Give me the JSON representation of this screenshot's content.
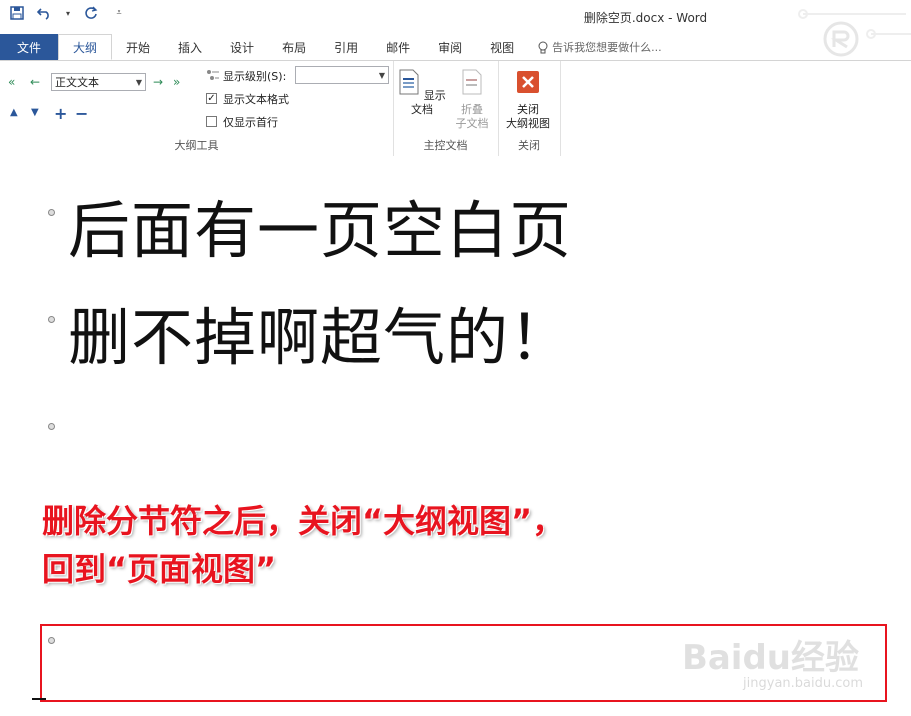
{
  "window": {
    "title": "删除空页.docx - Word"
  },
  "tabs": [
    "文件",
    "大纲",
    "开始",
    "插入",
    "设计",
    "布局",
    "引用",
    "邮件",
    "审阅",
    "视图"
  ],
  "tell_me": "告诉我您想要做什么...",
  "ribbon": {
    "outline_tools": {
      "level_value": "正文文本",
      "show_level_label": "显示级别(S):",
      "show_text_format": "显示文本格式",
      "show_first_line": "仅显示首行",
      "group_label": "大纲工具"
    },
    "master_doc": {
      "show_document": "显示文档",
      "collapse_1": "折叠",
      "collapse_2": "子文档",
      "group_label": "主控文档"
    },
    "close": {
      "close_1": "关闭",
      "close_2": "大纲视图",
      "group_label": "关闭"
    }
  },
  "document": {
    "line1": "后面有一页空白页",
    "line2": "删不掉啊超气的！"
  },
  "annotation": {
    "line1": "删除分节符之后，关闭“大纲视图”，",
    "line2": "回到“页面视图”"
  },
  "watermark": {
    "brand": "Baidu经验",
    "url": "jingyan.baidu.com"
  },
  "colors": {
    "word_blue": "#2b579a",
    "annotation_red": "#e8141f"
  }
}
